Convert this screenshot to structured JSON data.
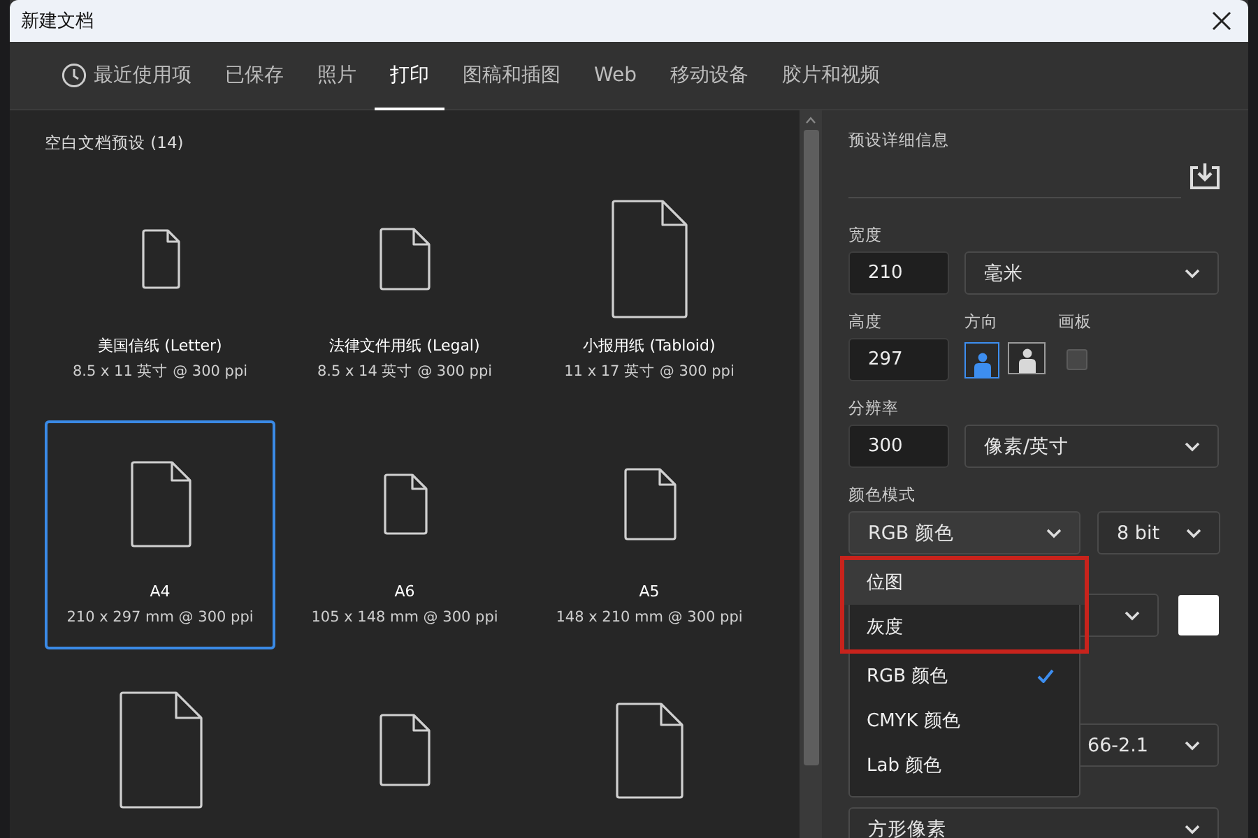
{
  "window": {
    "title": "新建文档"
  },
  "tabs": [
    {
      "label": "最近使用项",
      "selected": false
    },
    {
      "label": "已保存",
      "selected": false
    },
    {
      "label": "照片",
      "selected": false
    },
    {
      "label": "打印",
      "selected": true
    },
    {
      "label": "图稿和插图",
      "selected": false
    },
    {
      "label": "Web",
      "selected": false
    },
    {
      "label": "移动设备",
      "selected": false
    },
    {
      "label": "胶片和视频",
      "selected": false
    }
  ],
  "presets": {
    "heading": "空白文档预设 (14)",
    "items": [
      {
        "name": "美国信纸 (Letter)",
        "size": "8.5 x 11 英寸 @ 300 ppi",
        "selected": false
      },
      {
        "name": "法律文件用纸 (Legal)",
        "size": "8.5 x 14 英寸 @ 300 ppi",
        "selected": false
      },
      {
        "name": "小报用纸 (Tabloid)",
        "size": "11 x 17 英寸 @ 300 ppi",
        "selected": false
      },
      {
        "name": "A4",
        "size": "210 x 297 mm @ 300 ppi",
        "selected": true
      },
      {
        "name": "A6",
        "size": "105 x 148 mm @ 300 ppi",
        "selected": false
      },
      {
        "name": "A5",
        "size": "148 x 210 mm @ 300 ppi",
        "selected": false
      },
      {
        "selected": false
      },
      {
        "selected": false
      },
      {
        "selected": false
      }
    ]
  },
  "details": {
    "heading": "预设详细信息",
    "width": {
      "label": "宽度",
      "value": "210",
      "unit": "毫米"
    },
    "height": {
      "label": "高度",
      "value": "297"
    },
    "orientation": {
      "label": "方向",
      "options": [
        {
          "kind": "portrait",
          "selected": true
        },
        {
          "kind": "landscape",
          "selected": false
        }
      ]
    },
    "artboard": {
      "label": "画板",
      "checked": false
    },
    "resolution": {
      "label": "分辨率",
      "value": "300",
      "unit": "像素/英寸"
    },
    "color_mode": {
      "label": "颜色模式",
      "value": "RGB 颜色",
      "depth": "8 bit",
      "menu": [
        {
          "label": "位图",
          "hovered": true,
          "highlighted": true,
          "selected": false
        },
        {
          "label": "灰度",
          "hovered": false,
          "highlighted": true,
          "selected": false
        },
        {
          "label": "RGB 颜色",
          "hovered": false,
          "highlighted": false,
          "selected": true
        },
        {
          "label": "CMYK 颜色",
          "hovered": false,
          "highlighted": false,
          "selected": false
        },
        {
          "label": "Lab 颜色",
          "hovered": false,
          "highlighted": false,
          "selected": false
        }
      ]
    },
    "color_profile": {
      "value": "66-2.1"
    },
    "pixel_aspect": {
      "value": "方形像素"
    }
  }
}
